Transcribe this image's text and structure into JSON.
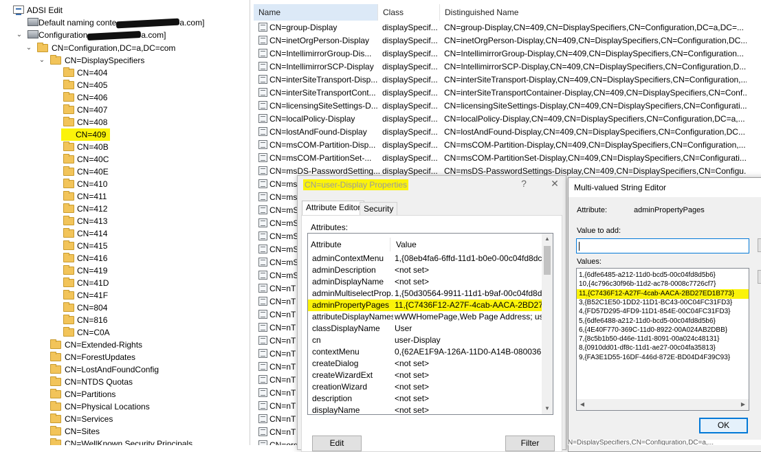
{
  "tree": {
    "root": "ADSI Edit",
    "default_naming": "Default naming conte",
    "default_naming_suffix": "a.com]",
    "configuration": "Configuration",
    "configuration_suffix": "a.com]",
    "config_dn": "CN=Configuration,DC=a,DC=com",
    "display_specifiers": "CN=DisplaySpecifiers",
    "locales": [
      "CN=404",
      "CN=405",
      "CN=406",
      "CN=407",
      "CN=408",
      "CN=409",
      "CN=40B",
      "CN=40C",
      "CN=40E",
      "CN=410",
      "CN=411",
      "CN=412",
      "CN=413",
      "CN=414",
      "CN=415",
      "CN=416",
      "CN=419",
      "CN=41D",
      "CN=41F",
      "CN=804",
      "CN=816",
      "CN=C0A"
    ],
    "siblings": [
      "CN=Extended-Rights",
      "CN=ForestUpdates",
      "CN=LostAndFoundConfig",
      "CN=NTDS Quotas",
      "CN=Partitions",
      "CN=Physical Locations",
      "CN=Services",
      "CN=Sites",
      "CN=WellKnown Security Principals"
    ]
  },
  "list": {
    "columns": [
      "Name",
      "Class",
      "Distinguished Name"
    ],
    "rows": [
      [
        "CN=group-Display",
        "displaySpecif...",
        "CN=group-Display,CN=409,CN=DisplaySpecifiers,CN=Configuration,DC=a,DC=..."
      ],
      [
        "CN=inetOrgPerson-Display",
        "displaySpecif...",
        "CN=inetOrgPerson-Display,CN=409,CN=DisplaySpecifiers,CN=Configuration,DC..."
      ],
      [
        "CN=IntellimirrorGroup-Dis...",
        "displaySpecif...",
        "CN=IntellimirrorGroup-Display,CN=409,CN=DisplaySpecifiers,CN=Configuration..."
      ],
      [
        "CN=IntellimirrorSCP-Display",
        "displaySpecif...",
        "CN=IntellimirrorSCP-Display,CN=409,CN=DisplaySpecifiers,CN=Configuration,D..."
      ],
      [
        "CN=interSiteTransport-Disp...",
        "displaySpecif...",
        "CN=interSiteTransport-Display,CN=409,CN=DisplaySpecifiers,CN=Configuration,..."
      ],
      [
        "CN=interSiteTransportCont...",
        "displaySpecif...",
        "CN=interSiteTransportContainer-Display,CN=409,CN=DisplaySpecifiers,CN=Conf..."
      ],
      [
        "CN=licensingSiteSettings-D...",
        "displaySpecif...",
        "CN=licensingSiteSettings-Display,CN=409,CN=DisplaySpecifiers,CN=Configurati..."
      ],
      [
        "CN=localPolicy-Display",
        "displaySpecif...",
        "CN=localPolicy-Display,CN=409,CN=DisplaySpecifiers,CN=Configuration,DC=a,..."
      ],
      [
        "CN=lostAndFound-Display",
        "displaySpecif...",
        "CN=lostAndFound-Display,CN=409,CN=DisplaySpecifiers,CN=Configuration,DC..."
      ],
      [
        "CN=msCOM-Partition-Disp...",
        "displaySpecif...",
        "CN=msCOM-Partition-Display,CN=409,CN=DisplaySpecifiers,CN=Configuration,..."
      ],
      [
        "CN=msCOM-PartitionSet-...",
        "displaySpecif...",
        "CN=msCOM-PartitionSet-Display,CN=409,CN=DisplaySpecifiers,CN=Configurati..."
      ],
      [
        "CN=msDS-PasswordSetting...",
        "displaySpecif...",
        "CN=msDS-PasswordSettings-Display,CN=409,CN=DisplaySpecifiers,CN=Configu..."
      ]
    ],
    "partial_rows": [
      "CN=ms",
      "CN=ms",
      "CN=mS",
      "CN=mS",
      "CN=mS",
      "CN=mS",
      "CN=mS",
      "CN=mS",
      "CN=nT",
      "CN=nT",
      "CN=nT",
      "CN=nT",
      "CN=nT",
      "CN=nT",
      "CN=nT",
      "CN=nT",
      "CN=nT",
      "CN=nT",
      "CN=nT",
      "CN=nT",
      "CN=org",
      "CN=pK"
    ]
  },
  "props": {
    "title": "CN=user-Display Properties",
    "help": "?",
    "close": "✕",
    "tabs": [
      "Attribute Editor",
      "Security"
    ],
    "attributes_label": "Attributes:",
    "col_attribute": "Attribute",
    "col_value": "Value",
    "rows": [
      [
        "adminContextMenu",
        "1,{08eb4fa6-6ffd-11d1-b0e0-00c04fd8dca6}"
      ],
      [
        "adminDescription",
        "<not set>"
      ],
      [
        "adminDisplayName",
        "<not set>"
      ],
      [
        "adminMultiselectProp...",
        "1,{50d30564-9911-11d1-b9af-00c04fd8d5b0"
      ],
      [
        "adminPropertyPages",
        "11,{C7436F12-A27F-4cab-AACA-2BD27ED1"
      ],
      [
        "attributeDisplayNames",
        "wWWHomePage,Web Page Address; userP"
      ],
      [
        "classDisplayName",
        "User"
      ],
      [
        "cn",
        "user-Display"
      ],
      [
        "contextMenu",
        "0,{62AE1F9A-126A-11D0-A14B-0800361B1"
      ],
      [
        "createDialog",
        "<not set>"
      ],
      [
        "createWizardExt",
        "<not set>"
      ],
      [
        "creationWizard",
        "<not set>"
      ],
      [
        "description",
        "<not set>"
      ],
      [
        "displayName",
        "<not set>"
      ]
    ],
    "selected_index": 4,
    "edit_label": "Edit",
    "filter_label": "Filter"
  },
  "mv": {
    "title": "Multi-valued String Editor",
    "attribute_label": "Attribute:",
    "attribute_value": "adminPropertyPages",
    "value_to_add_label": "Value to add:",
    "value_to_add": "",
    "values_label": "Values:",
    "values": [
      "1,{6dfe6485-a212-11d0-bcd5-00c04fd8d5b6}",
      "10,{4c796c30f96b-11d2-ac78-0008c7726cf7}",
      "11,{C7436F12-A27F-4cab-AACA-2BD27ED1B773}",
      "3,{B52C1E50-1DD2-11D1-BC43-00C04FC31FD3}",
      "4,{FD57D295-4FD9-11D1-854E-00C04FC31FD3}",
      "5,{6dfe6488-a212-11d0-bcd5-00c04fd8d5b6}",
      "6,{4E40F770-369C-11d0-8922-00A024AB2DBB}",
      "7,{8c5b1b50-d46e-11d1-8091-00a024c48131}",
      "8,{0910dd01-df8c-11d1-ae27-00c04fa35813}",
      "9,{FA3E1D55-16DF-446d-872E-BD04D4F39C93}"
    ],
    "selected_index": 2,
    "ok_label": "OK",
    "status_text": "N=DisplaySpecifiers,CN=Configuration,DC=a,..."
  },
  "colors": {
    "highlight": "#fbf30a",
    "selection_header": "#dce9f7",
    "focus": "#0078d7"
  }
}
